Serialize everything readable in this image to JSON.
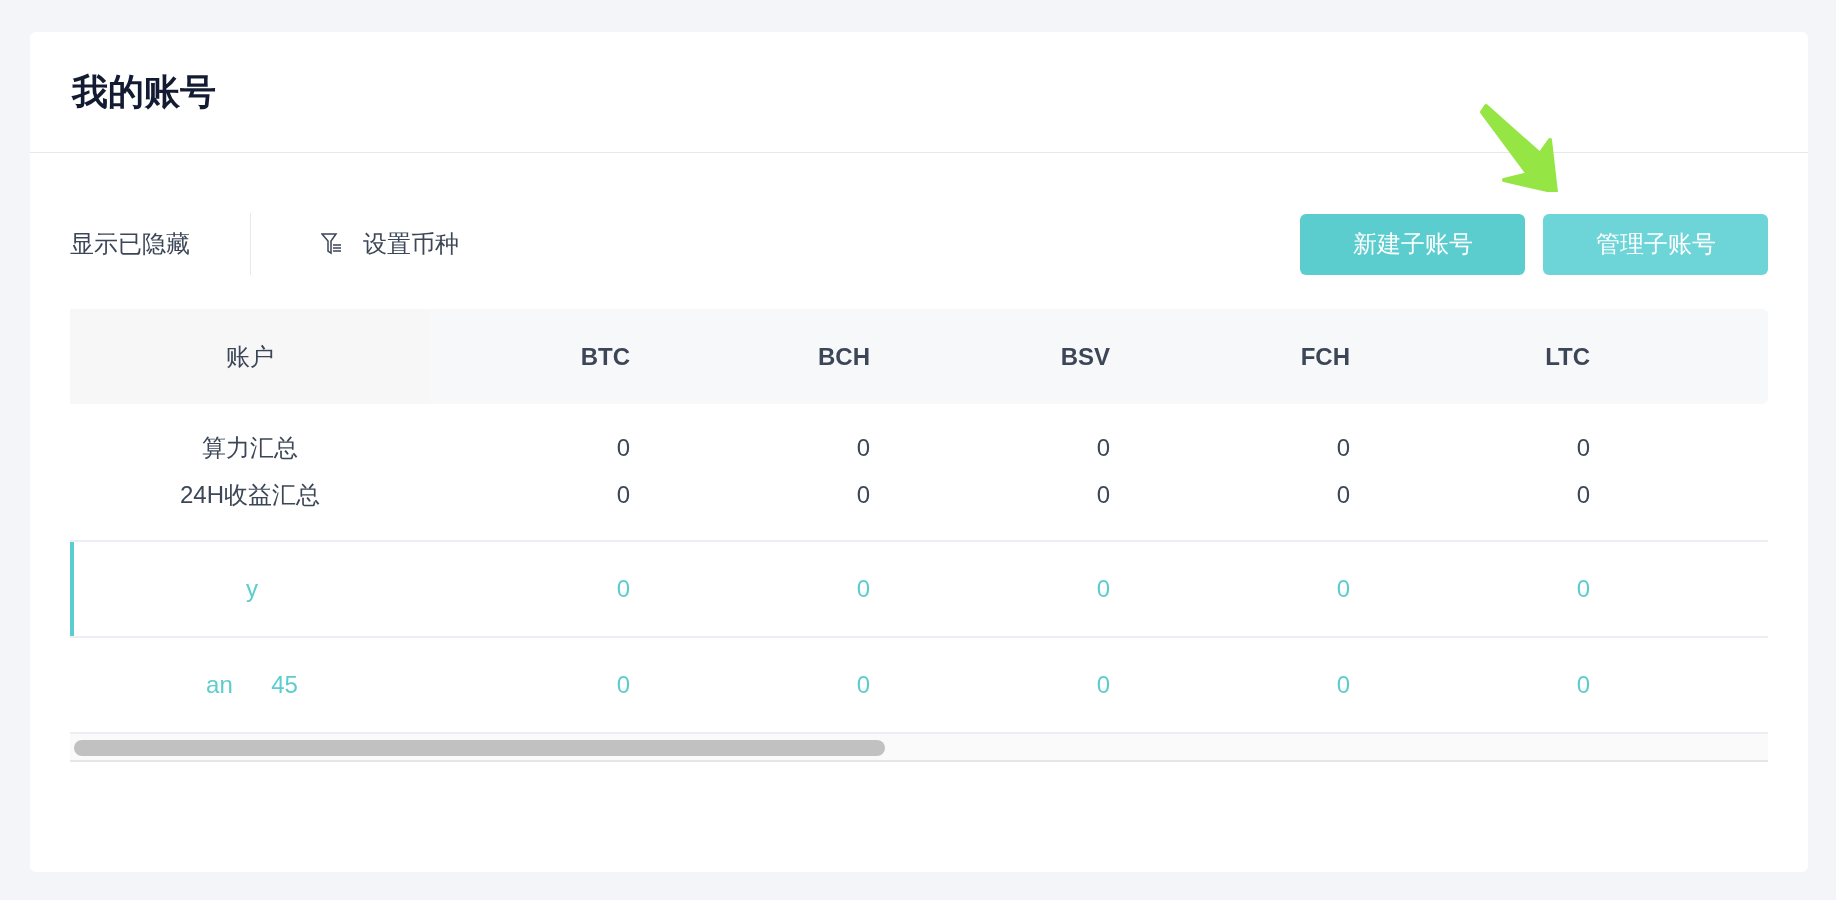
{
  "title": "我的账号",
  "toolbar": {
    "show_hidden": "显示已隐藏",
    "set_coins": "设置币种"
  },
  "buttons": [
    {
      "label": "新建子账号",
      "kind": "primary"
    },
    {
      "label": "管理子账号",
      "kind": "light"
    }
  ],
  "table": {
    "columns": [
      "账户",
      "BTC",
      "BCH",
      "BSV",
      "FCH",
      "LTC"
    ],
    "summary": [
      {
        "label": "算力汇总",
        "values": [
          "0",
          "0",
          "0",
          "0",
          "0"
        ]
      },
      {
        "label": "24H收益汇总",
        "values": [
          "0",
          "0",
          "0",
          "0",
          "0"
        ]
      }
    ],
    "rows": [
      {
        "name_parts": [
          "y"
        ],
        "selected": true,
        "values": [
          "0",
          "0",
          "0",
          "0",
          "0"
        ]
      },
      {
        "name_parts": [
          "an",
          "45"
        ],
        "selected": false,
        "values": [
          "0",
          "0",
          "0",
          "0",
          "0"
        ]
      }
    ]
  }
}
